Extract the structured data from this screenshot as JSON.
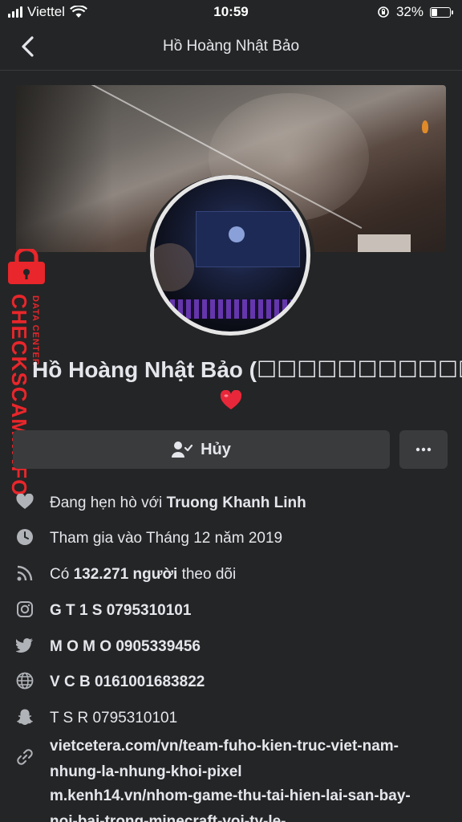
{
  "status_bar": {
    "carrier": "Viettel",
    "time": "10:59",
    "battery_percent": "32%",
    "battery_level": 0.32
  },
  "nav": {
    "title": "Hồ Hoàng Nhật Bảo"
  },
  "profile": {
    "name": "Hồ Hoàng Nhật Bảo (☐☐☐☐☐☐☐☐☐☐☐☐☐☐☐☐☐☐☐☐☐)",
    "emoji": "heart"
  },
  "watermark": {
    "brand": "CHECKSCAM.INFO",
    "sub": "DATA CENTER"
  },
  "actions": {
    "cancel_label": "Hủy",
    "more_label": "···"
  },
  "info": {
    "relationship_prefix": "Đang hẹn hò với ",
    "relationship_name": "Truong Khanh Linh",
    "joined": "Tham gia vào Tháng 12 năm 2019",
    "followers_prefix": "Có ",
    "followers_count": "132.271 người",
    "followers_suffix": " theo dõi",
    "instagram": "G T 1 S 0795310101",
    "twitter": "M O M O 0905339456",
    "website": "V C B 0161001683822",
    "snapchat": "T S R 0795310101",
    "link1_line1": "vietcetera.com/vn/team-fuho-kien-truc-viet-nam-",
    "link1_line2": "nhung-la-nhung-khoi-pixel",
    "link2_line1": "m.kenh14.vn/nhom-game-thu-tai-hien-lai-san-bay-",
    "link2_line2": "noi-bai-trong-minecraft-voi-ty-le-"
  }
}
